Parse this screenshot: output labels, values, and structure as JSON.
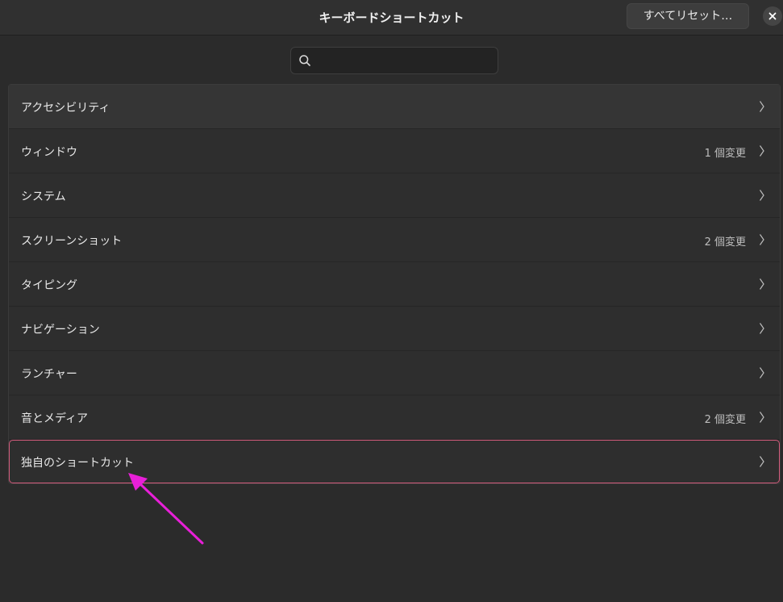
{
  "window": {
    "title": "キーボードショートカット",
    "reset_label": "すべてリセット…"
  },
  "search": {
    "placeholder": "",
    "value": ""
  },
  "categories": [
    {
      "label": "アクセシビリティ",
      "status": ""
    },
    {
      "label": "ウィンドウ",
      "status": "1 個変更"
    },
    {
      "label": "システム",
      "status": ""
    },
    {
      "label": "スクリーンショット",
      "status": "2 個変更"
    },
    {
      "label": "タイピング",
      "status": ""
    },
    {
      "label": "ナビゲーション",
      "status": ""
    },
    {
      "label": "ランチャー",
      "status": ""
    },
    {
      "label": "音とメディア",
      "status": "2 個変更"
    },
    {
      "label": "独自のショートカット",
      "status": ""
    }
  ],
  "icons": {
    "close": "close-icon",
    "search": "search-icon",
    "chevron": "chevron-right-icon"
  },
  "colors": {
    "highlight": "#d35b7c",
    "arrow": "#e81fd8"
  }
}
